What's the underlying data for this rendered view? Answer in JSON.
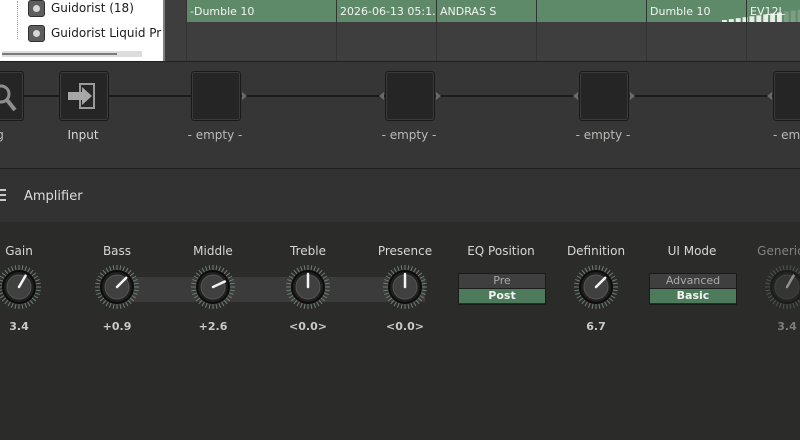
{
  "browser": {
    "tree_items": [
      {
        "label": "Guidorist (18)"
      },
      {
        "label": "Guidorist Liquid Pr"
      }
    ],
    "selected_row": {
      "name": "-Dumble 10",
      "date": "2026-06-13 05:1...",
      "author": "ANDRAS S",
      "rating": 0.55,
      "model": "Dumble 10",
      "cab": "EV12L"
    }
  },
  "chain": {
    "partial_left_label": "g",
    "slots": [
      {
        "label": "Input",
        "kind": "input-icon"
      },
      {
        "label": "- empty -"
      },
      {
        "label": "- empty -"
      },
      {
        "label": "- empty -"
      },
      {
        "label": "- emp"
      }
    ]
  },
  "section": {
    "title": "Amplifier"
  },
  "controls": [
    {
      "label": "Gain",
      "value": "3.4",
      "angle": 30
    },
    {
      "label": "Bass",
      "value": "+0.9",
      "angle": 45
    },
    {
      "label": "Middle",
      "value": "+2.6",
      "angle": 65
    },
    {
      "label": "Treble",
      "value": "<0.0>",
      "angle": 0
    },
    {
      "label": "Presence",
      "value": "<0.0>",
      "angle": 0
    },
    {
      "label": "Definition",
      "value": "6.7",
      "angle": 45
    },
    {
      "label": "Generic G",
      "value": "3.4",
      "angle": 30
    }
  ],
  "eq_position": {
    "label": "EQ Position",
    "options": [
      "Pre",
      "Post"
    ],
    "selected": "Post"
  },
  "ui_mode": {
    "label": "UI Mode",
    "options": [
      "Advanced",
      "Basic"
    ],
    "selected": "Basic"
  },
  "colors": {
    "accent": "#5f8a6a",
    "toggle_on": "#4d7a5a",
    "background": "#2c2d2b"
  }
}
